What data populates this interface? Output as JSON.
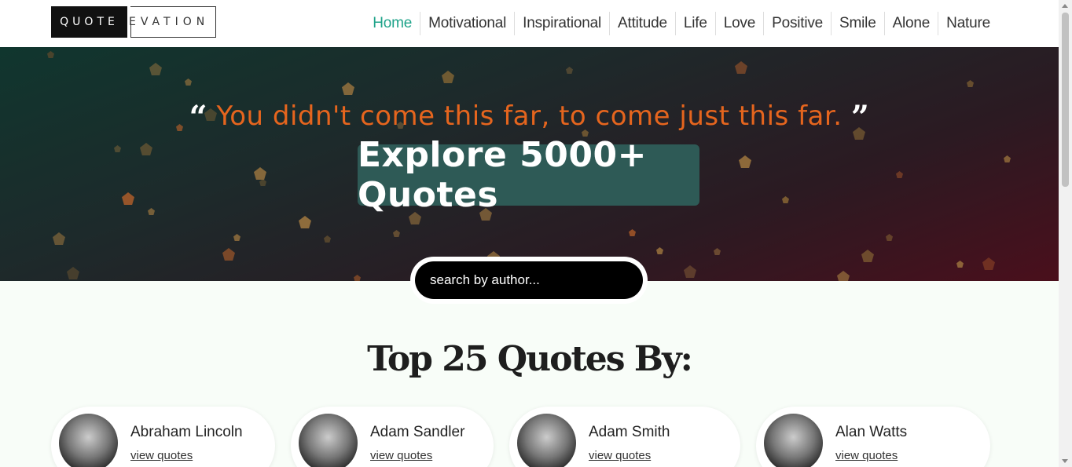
{
  "logo": {
    "left": "QUOTE",
    "right": "EVATION"
  },
  "nav": {
    "items": [
      {
        "label": "Home",
        "active": true
      },
      {
        "label": "Motivational"
      },
      {
        "label": "Inspirational"
      },
      {
        "label": "Attitude"
      },
      {
        "label": "Life"
      },
      {
        "label": "Love"
      },
      {
        "label": "Positive"
      },
      {
        "label": "Smile"
      },
      {
        "label": "Alone"
      },
      {
        "label": "Nature"
      }
    ]
  },
  "hero": {
    "quote": "You didn't come this far, to come just this far.",
    "open_mark": "“",
    "close_mark": "”",
    "explore_label": "Explore 5000+ Quotes"
  },
  "search": {
    "placeholder": "search by author..."
  },
  "section": {
    "title": "Top 25 Quotes By:"
  },
  "authors": [
    {
      "name": "Abraham Lincoln",
      "link": "view quotes"
    },
    {
      "name": "Adam Sandler",
      "link": "view quotes"
    },
    {
      "name": "Adam Smith",
      "link": "view quotes"
    },
    {
      "name": "Alan Watts",
      "link": "view quotes"
    }
  ],
  "colors": {
    "accent": "#1fa38a",
    "quote": "#e5651e",
    "explore_bg": "#2e5a56"
  }
}
